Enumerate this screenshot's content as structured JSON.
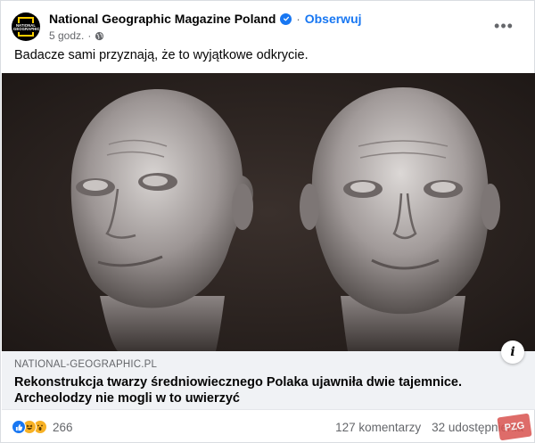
{
  "post": {
    "page_name": "National Geographic Magazine Poland",
    "separator": "·",
    "follow_label": "Obserwuj",
    "timestamp": "5 godz.",
    "time_separator": "·",
    "audience_icon": "globe-icon",
    "more_icon": "more-options-icon",
    "text": "Badacze sami przyznają, że to wyjątkowe odkrycie."
  },
  "avatar": {
    "logo_text": "NATIONAL GEOGRAPHIC"
  },
  "link_preview": {
    "domain": "NATIONAL-GEOGRAPHIC.PL",
    "title": "Rekonstrukcja twarzy średniowiecznego Polaka ujawniła dwie tajemnice. Archeolodzy nie mogli w to uwierzyć",
    "info_icon": "i"
  },
  "footer": {
    "reactions": [
      "like-icon",
      "haha-icon",
      "wow-icon"
    ],
    "reaction_count": "266",
    "comments": "127 komentarzy",
    "shares": "32 udostępnienia"
  },
  "watermark": {
    "text": "PZG"
  },
  "colors": {
    "brand_blue": "#1877f2",
    "secondary_text": "#65676b",
    "preview_bg": "#f0f2f5",
    "natgeo_yellow": "#ffce00"
  }
}
